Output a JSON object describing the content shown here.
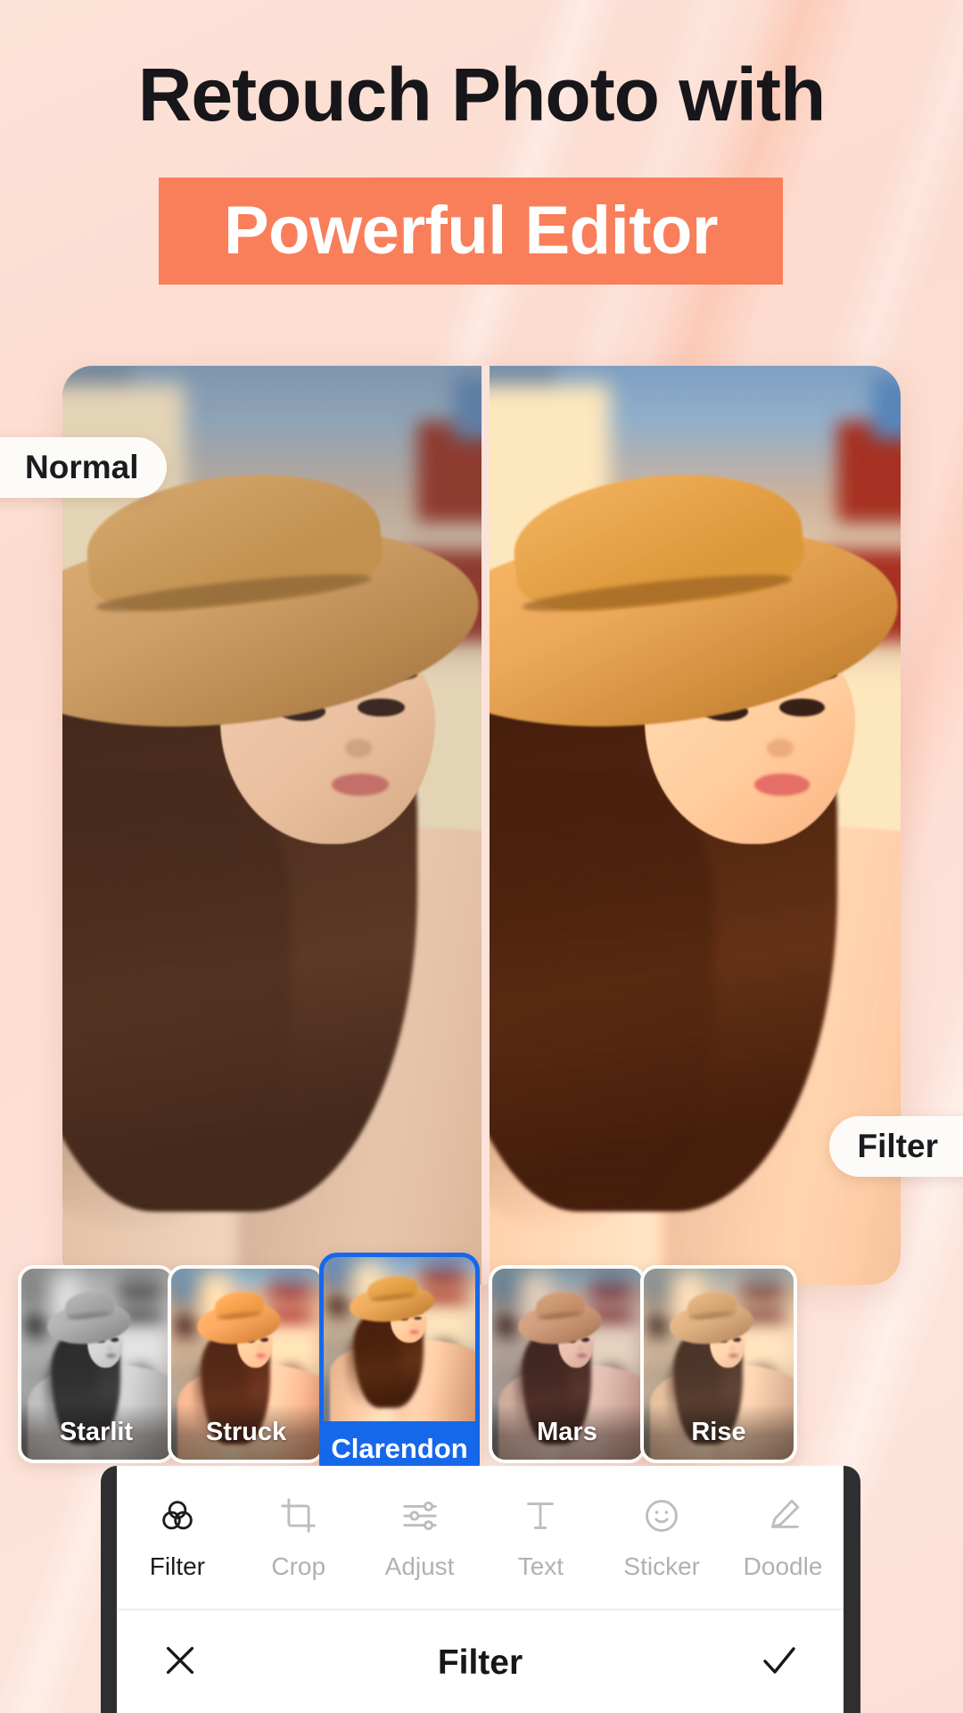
{
  "theme": {
    "background": "#fddcd0",
    "banner_color": "#f97e5a",
    "accent_blue": "#1668ea",
    "headline_color": "#17161a",
    "phone_frame": "#2f2f31"
  },
  "header": {
    "line1": "Retouch Photo with",
    "line2": "Powerful Editor"
  },
  "preview": {
    "left_badge": "Normal",
    "right_badge": "Filter"
  },
  "filters": {
    "items": [
      {
        "label": "Starlit",
        "selected": false,
        "style": "f-starlit"
      },
      {
        "label": "Struck",
        "selected": false,
        "style": "f-struck"
      },
      {
        "label": "Clarendon",
        "selected": true,
        "style": "f-clarendon"
      },
      {
        "label": "Mars",
        "selected": false,
        "style": "f-mars"
      },
      {
        "label": "Rise",
        "selected": false,
        "style": "f-rise"
      }
    ],
    "selected_label": "Clarendon"
  },
  "toolbar": {
    "items": [
      {
        "label": "Filter",
        "icon": "filter-circles-icon",
        "active": true
      },
      {
        "label": "Crop",
        "icon": "crop-icon",
        "active": false
      },
      {
        "label": "Adjust",
        "icon": "sliders-icon",
        "active": false
      },
      {
        "label": "Text",
        "icon": "text-t-icon",
        "active": false
      },
      {
        "label": "Sticker",
        "icon": "smiley-icon",
        "active": false
      },
      {
        "label": "Doodle",
        "icon": "pencil-icon",
        "active": false
      }
    ]
  },
  "actionbar": {
    "cancel_icon": "close-x-icon",
    "title": "Filter",
    "confirm_icon": "check-icon"
  }
}
